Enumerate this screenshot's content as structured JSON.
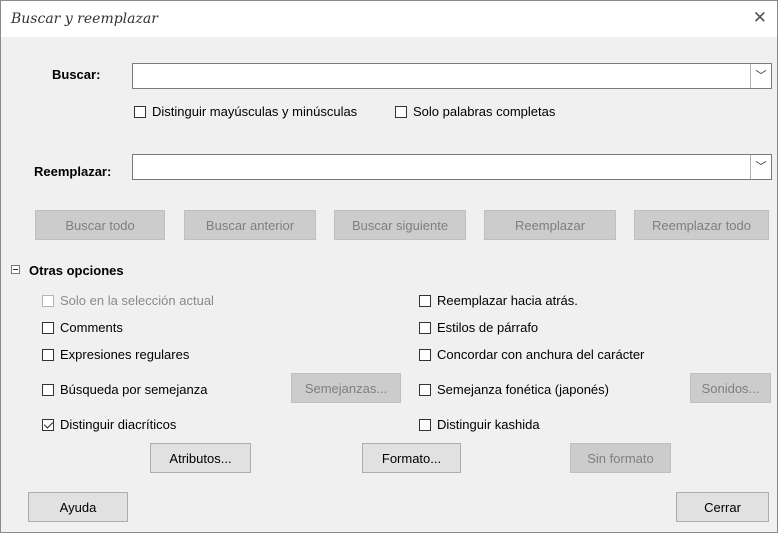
{
  "window": {
    "title": "Buscar y reemplazar"
  },
  "search": {
    "label": "Buscar:",
    "value": "",
    "match_case": {
      "label": "Distinguir mayúsculas y minúsculas",
      "checked": false
    },
    "whole_words": {
      "label": "Solo palabras completas",
      "checked": false
    }
  },
  "replace": {
    "label": "Reemplazar:",
    "value": ""
  },
  "action_buttons": {
    "find_all": "Buscar todo",
    "find_previous": "Buscar anterior",
    "find_next": "Buscar siguiente",
    "replace": "Reemplazar",
    "replace_all": "Reemplazar todo"
  },
  "other_options": {
    "header": "Otras opciones",
    "current_selection_only": {
      "label": "Solo en la selección actual",
      "checked": false,
      "enabled": false
    },
    "comments": {
      "label": "Comments",
      "checked": false
    },
    "regular_expressions": {
      "label": "Expresiones regulares",
      "checked": false
    },
    "similarity_search": {
      "label": "Búsqueda por semejanza",
      "checked": false
    },
    "similarities_button": "Semejanzas...",
    "diacritics": {
      "label": "Distinguir diacríticos",
      "checked": true
    },
    "replace_backwards": {
      "label": "Reemplazar hacia atrás.",
      "checked": false
    },
    "paragraph_styles": {
      "label": "Estilos de párrafo",
      "checked": false
    },
    "match_char_width": {
      "label": "Concordar con anchura del carácter",
      "checked": false
    },
    "sounds_like": {
      "label": "Semejanza fonética (japonés)",
      "checked": false
    },
    "sounds_button": "Sonidos...",
    "kashida": {
      "label": "Distinguir kashida",
      "checked": false
    },
    "attributes_button": "Atributos...",
    "format_button": "Formato...",
    "no_format_button": "Sin formato"
  },
  "footer": {
    "help": "Ayuda",
    "close": "Cerrar"
  }
}
